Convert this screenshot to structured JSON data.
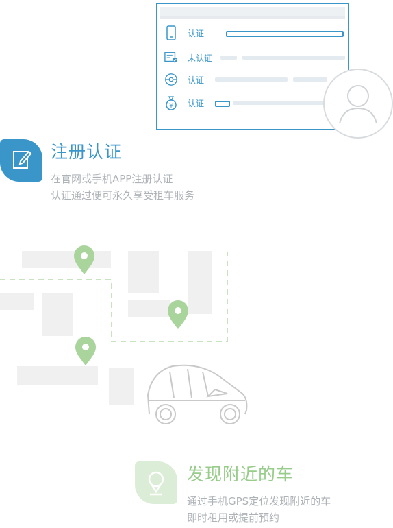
{
  "card": {
    "rows": [
      {
        "icon": "phone-icon",
        "label": "认证"
      },
      {
        "icon": "id-card-icon",
        "label": "未认证"
      },
      {
        "icon": "steering-wheel-icon",
        "label": "认证"
      },
      {
        "icon": "money-bag-icon",
        "label": "认证"
      }
    ]
  },
  "section1": {
    "title": "注册认证",
    "line1": "在官网或手机APP注册认证",
    "line2": "认证通过便可永久享受租车服务"
  },
  "section2": {
    "title": "发现附近的车",
    "line1": "通过手机GPS定位发现附近的车",
    "line2": "即时租用或提前预约"
  },
  "colors": {
    "blue": "#3a95c9",
    "green": "#97cc8a",
    "gray": "#aeb3b8"
  }
}
